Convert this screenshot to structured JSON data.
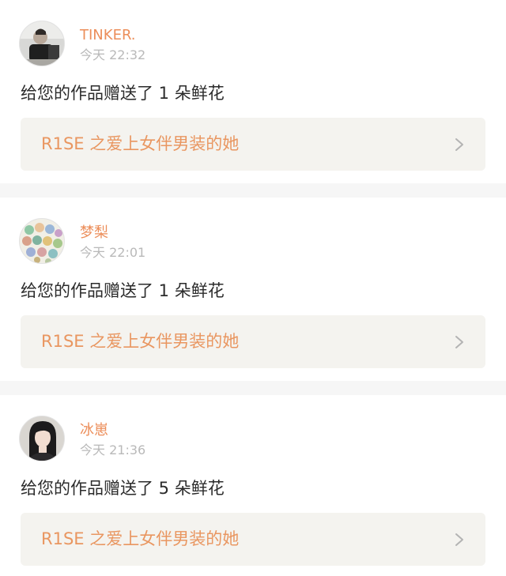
{
  "notifications": [
    {
      "username": "TINKER.",
      "time": "今天 22:32",
      "message": "给您的作品赠送了 1 朵鲜花",
      "work_title": "R1SE 之爱上女伴男装的她",
      "avatar_icon": "avatar-photo-person"
    },
    {
      "username": "梦梨",
      "time": "今天 22:01",
      "message": "给您的作品赠送了 1 朵鲜花",
      "work_title": "R1SE 之爱上女伴男装的她",
      "avatar_icon": "avatar-cartoon-group"
    },
    {
      "username": "冰崽",
      "time": "今天 21:36",
      "message": "给您的作品赠送了 5 朵鲜花",
      "work_title": "R1SE 之爱上女伴男装的她",
      "avatar_icon": "avatar-photo-girl"
    }
  ],
  "colors": {
    "username": "#ec8e5a",
    "work_title": "#e99660",
    "time": "#b9b9b9",
    "message": "#2b2b2b",
    "link_background": "#f4f3ef",
    "separator": "#f6f6f6"
  },
  "icons": {
    "chevron": "chevron-right-icon"
  }
}
